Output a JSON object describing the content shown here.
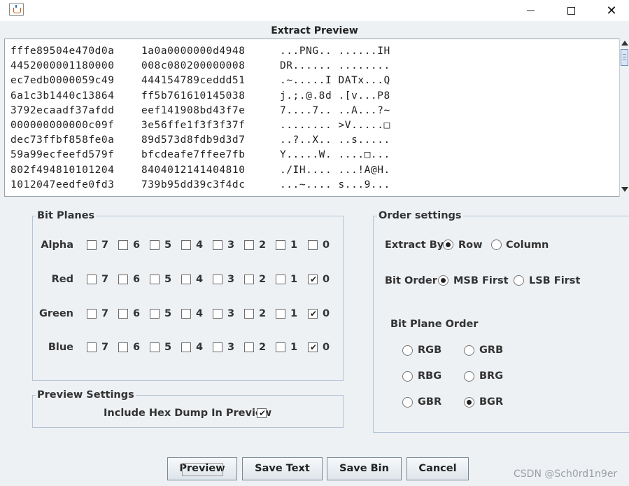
{
  "window": {
    "title_bar_buttons": {
      "minimize": "minimize-icon",
      "maximize": "maximize-icon",
      "close": "✕"
    }
  },
  "dialog_title": "Extract Preview",
  "hex_preview": {
    "lines": [
      {
        "hex1": "fffe89504e470d0a",
        "hex2": "1a0a0000000d4948",
        "ascii": "...PNG.. ......IH"
      },
      {
        "hex1": "4452000001180000",
        "hex2": "008c080200000008",
        "ascii": "DR...... ........"
      },
      {
        "hex1": "ec7edb0000059c49",
        "hex2": "444154789ceddd51",
        "ascii": ".~.....I DATx...Q"
      },
      {
        "hex1": "6a1c3b1440c13864",
        "hex2": "ff5b761610145038",
        "ascii": "j.;.@.8d .[v...P8"
      },
      {
        "hex1": "3792ecaadf37afdd",
        "hex2": "eef141908bd43f7e",
        "ascii": "7....7.. ..A...?~"
      },
      {
        "hex1": "000000000000c09f",
        "hex2": "3e56ffe1f3f3f37f",
        "ascii": "........ >V.....□"
      },
      {
        "hex1": "dec73ffbf858fe0a",
        "hex2": "89d573d8fdb9d3d7",
        "ascii": "..?..X.. ..s....."
      },
      {
        "hex1": "59a99ecfeefd579f",
        "hex2": "bfcdeafe7ffee7fb",
        "ascii": "Y.....W. ....□..."
      },
      {
        "hex1": "802f494810101204",
        "hex2": "8404012141404810",
        "ascii": "./IH.... ...!A@H."
      },
      {
        "hex1": "1012047eedfe0fd3",
        "hex2": "739b95dd39c3f4dc",
        "ascii": "...~.... s...9..."
      }
    ]
  },
  "bit_planes": {
    "title": "Bit Planes",
    "channels": [
      {
        "name": "Alpha",
        "checked": [
          false,
          false,
          false,
          false,
          false,
          false,
          false,
          false
        ]
      },
      {
        "name": "Red",
        "checked": [
          false,
          false,
          false,
          false,
          false,
          false,
          false,
          true
        ]
      },
      {
        "name": "Green",
        "checked": [
          false,
          false,
          false,
          false,
          false,
          false,
          false,
          true
        ]
      },
      {
        "name": "Blue",
        "checked": [
          false,
          false,
          false,
          false,
          false,
          false,
          false,
          true
        ]
      }
    ],
    "bits": [
      "7",
      "6",
      "5",
      "4",
      "3",
      "2",
      "1",
      "0"
    ]
  },
  "preview_settings": {
    "title": "Preview Settings",
    "hex_dump_label": "Include Hex Dump In Preview",
    "hex_dump_checked": true
  },
  "order_settings": {
    "title": "Order settings",
    "extract_by_label": "Extract By",
    "extract_by_options": [
      {
        "label": "Row",
        "selected": true
      },
      {
        "label": "Column",
        "selected": false
      }
    ],
    "bit_order_label": "Bit Order",
    "bit_order_options": [
      {
        "label": "MSB First",
        "selected": true
      },
      {
        "label": "LSB First",
        "selected": false
      }
    ],
    "bit_plane_order_label": "Bit Plane Order",
    "bit_plane_order_options": [
      {
        "label": "RGB",
        "selected": false
      },
      {
        "label": "GRB",
        "selected": false
      },
      {
        "label": "RBG",
        "selected": false
      },
      {
        "label": "BRG",
        "selected": false
      },
      {
        "label": "GBR",
        "selected": false
      },
      {
        "label": "BGR",
        "selected": true
      }
    ]
  },
  "buttons": {
    "preview": "Preview",
    "save_text": "Save Text",
    "save_bin": "Save Bin",
    "cancel": "Cancel"
  },
  "watermark": "CSDN @Sch0rd1n9er",
  "check_glyph": "✔"
}
